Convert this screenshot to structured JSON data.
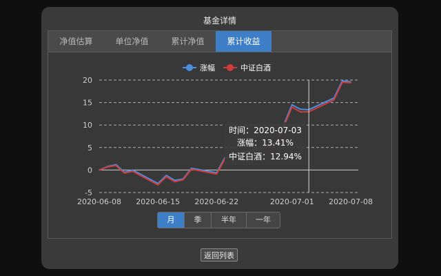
{
  "modal": {
    "title": "基金详情"
  },
  "tabs": [
    {
      "label": "净值估算",
      "active": false
    },
    {
      "label": "单位净值",
      "active": false
    },
    {
      "label": "累计净值",
      "active": false
    },
    {
      "label": "累计收益",
      "active": true
    }
  ],
  "range_buttons": [
    {
      "label": "月",
      "active": true
    },
    {
      "label": "季",
      "active": false
    },
    {
      "label": "半年",
      "active": false
    },
    {
      "label": "一年",
      "active": false
    }
  ],
  "back_button": {
    "label": "返回列表"
  },
  "tooltip": {
    "time_line": "时间：2020-07-03",
    "series1_line": "涨幅：13.41%",
    "series2_line": "中证白酒：12.94%"
  },
  "colors": {
    "series1": "#4a90e2",
    "series2": "#d23b3b",
    "active_tab": "#3d7ec6"
  },
  "chart_data": {
    "type": "line",
    "title": "",
    "xlabel": "",
    "ylabel": "",
    "ylim": [
      -5,
      20
    ],
    "xlim": [
      "2020-06-05",
      "2020-07-08"
    ],
    "grid": true,
    "legend_placement": "top-center",
    "y_ticks": [
      "-5",
      "0",
      "5",
      "10",
      "15",
      "20"
    ],
    "x_ticks": [
      "2020-06-08",
      "2020-06-15",
      "2020-06-22",
      "2020-07-01",
      "2020-07-08"
    ],
    "x": [
      "2020-06-08",
      "2020-06-09",
      "2020-06-10",
      "2020-06-11",
      "2020-06-12",
      "2020-06-15",
      "2020-06-16",
      "2020-06-17",
      "2020-06-18",
      "2020-06-19",
      "2020-06-22",
      "2020-06-23",
      "2020-06-24",
      "2020-06-29",
      "2020-06-30",
      "2020-07-01",
      "2020-07-02",
      "2020-07-03",
      "2020-07-06",
      "2020-07-07",
      "2020-07-08"
    ],
    "series": [
      {
        "name": "涨幅",
        "values": [
          0,
          0.8,
          1.2,
          -0.5,
          0,
          -3,
          -1.2,
          -2.3,
          -2,
          0.4,
          -0.6,
          2.8,
          3.5,
          5.8,
          10,
          14.5,
          13.5,
          13.41,
          16,
          19.8,
          19.6
        ]
      },
      {
        "name": "中证白酒",
        "values": [
          0,
          0.7,
          1,
          -0.7,
          -0.3,
          -3.3,
          -1.5,
          -2.6,
          -2.2,
          0.2,
          -0.9,
          2.5,
          3.2,
          5.5,
          9.6,
          14,
          12.9,
          12.94,
          15.6,
          19.5,
          19.4
        ]
      }
    ]
  }
}
